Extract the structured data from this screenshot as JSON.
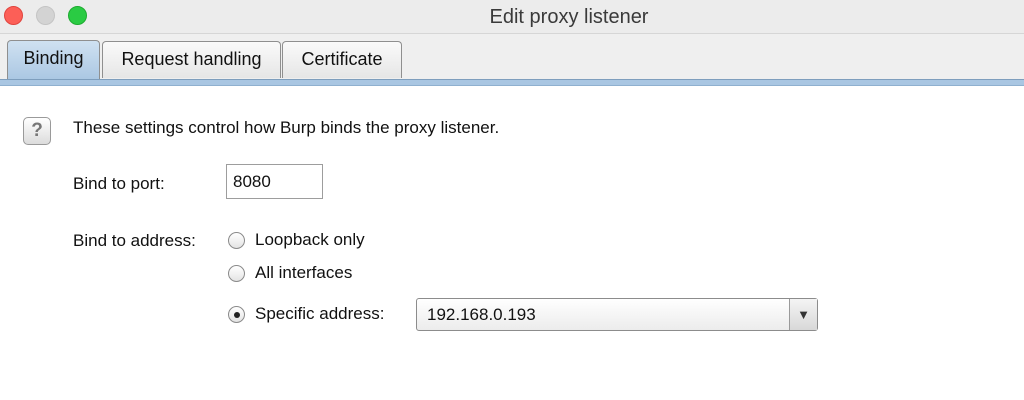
{
  "window": {
    "title": "Edit proxy listener"
  },
  "tabs": [
    {
      "label": "Binding",
      "active": true
    },
    {
      "label": "Request handling",
      "active": false
    },
    {
      "label": "Certificate",
      "active": false
    }
  ],
  "help": {
    "icon": "question-mark",
    "text": "These settings control how Burp binds the proxy listener."
  },
  "port": {
    "label": "Bind to port:",
    "value": "8080"
  },
  "address": {
    "label": "Bind to address:",
    "options": [
      {
        "label": "Loopback only",
        "selected": false
      },
      {
        "label": "All interfaces",
        "selected": false
      },
      {
        "label": "Specific address:",
        "selected": true
      }
    ],
    "specific_value": "192.168.0.193"
  },
  "colors": {
    "active_tab": "#a9c6e2",
    "close": "#fc5f57",
    "maximize": "#2acb43"
  }
}
